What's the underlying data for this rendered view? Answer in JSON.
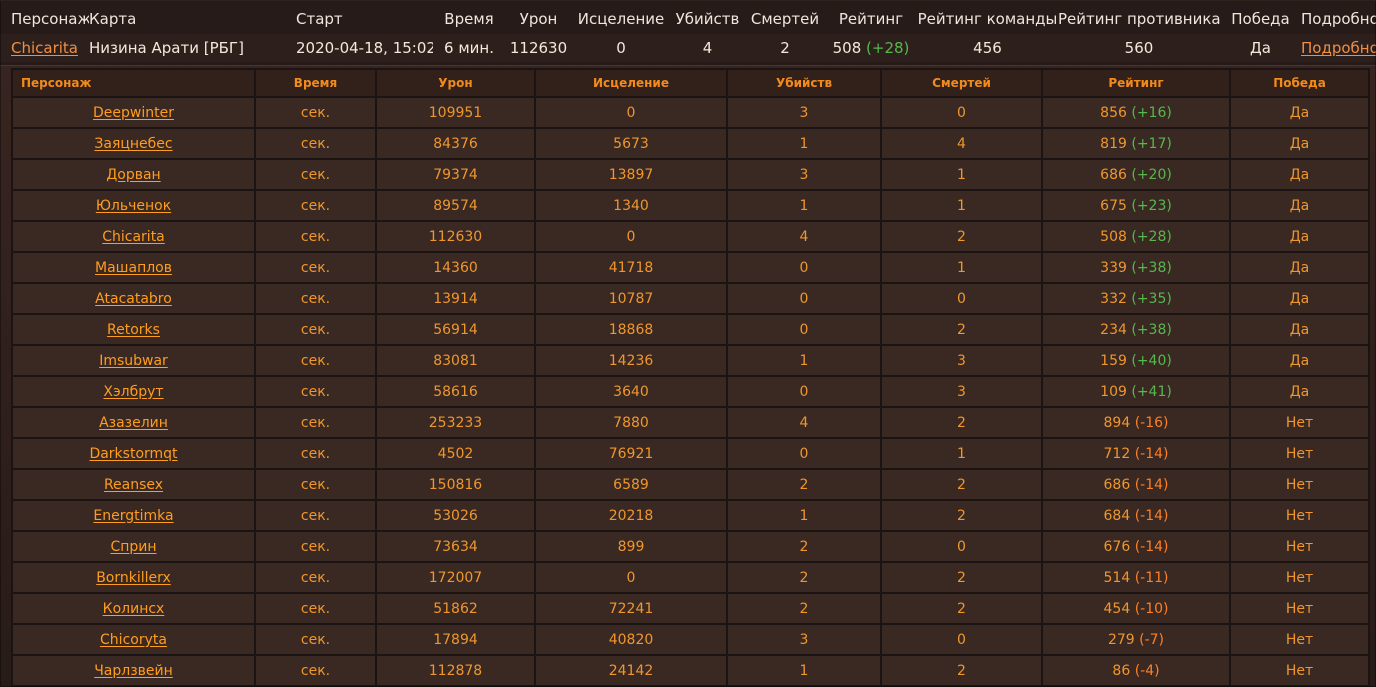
{
  "theme": {
    "background": "#2e201c",
    "header_accent": "#f28b1c",
    "link": "#ef8f47",
    "positive": "#56b84d",
    "negative": "#ff7f23"
  },
  "match_summary": {
    "headers": {
      "character": "Персонаж",
      "map": "Карта",
      "start": "Старт",
      "time": "Время",
      "damage": "Урон",
      "healing": "Исцеление",
      "kills": "Убийств",
      "deaths": "Смертей",
      "rating": "Рейтинг",
      "team_rating": "Рейтинг команды",
      "opponent_rating": "Рейтинг противника",
      "victory": "Победа",
      "details": "Подробно"
    },
    "row": {
      "character": "Chicarita",
      "map": "Низина Арати [РБГ]",
      "start": "2020-04-18, 15:02",
      "time": "6 мин.",
      "damage": "112630",
      "healing": "0",
      "kills": "4",
      "deaths": "2",
      "rating_base": "508",
      "rating_delta": "(+28)",
      "team_rating": "456",
      "opponent_rating": "560",
      "victory": "Да",
      "details": "Подробно"
    }
  },
  "player_table": {
    "headers": {
      "character": "Персонаж",
      "time": "Время",
      "damage": "Урон",
      "healing": "Исцеление",
      "kills": "Убийств",
      "deaths": "Смертей",
      "rating": "Рейтинг",
      "victory": "Победа"
    },
    "rows": [
      {
        "name": "Deepwinter",
        "time": "сек.",
        "damage": "109951",
        "healing": "0",
        "kills": "3",
        "deaths": "0",
        "rating_base": "856",
        "rating_delta": "(+16)",
        "victory": "Да"
      },
      {
        "name": "Заяцнебес",
        "time": "сек.",
        "damage": "84376",
        "healing": "5673",
        "kills": "1",
        "deaths": "4",
        "rating_base": "819",
        "rating_delta": "(+17)",
        "victory": "Да"
      },
      {
        "name": "Дорван",
        "time": "сек.",
        "damage": "79374",
        "healing": "13897",
        "kills": "3",
        "deaths": "1",
        "rating_base": "686",
        "rating_delta": "(+20)",
        "victory": "Да"
      },
      {
        "name": "Юльченок",
        "time": "сек.",
        "damage": "89574",
        "healing": "1340",
        "kills": "1",
        "deaths": "1",
        "rating_base": "675",
        "rating_delta": "(+23)",
        "victory": "Да"
      },
      {
        "name": "Chicarita",
        "time": "сек.",
        "damage": "112630",
        "healing": "0",
        "kills": "4",
        "deaths": "2",
        "rating_base": "508",
        "rating_delta": "(+28)",
        "victory": "Да"
      },
      {
        "name": "Машаплов",
        "time": "сек.",
        "damage": "14360",
        "healing": "41718",
        "kills": "0",
        "deaths": "1",
        "rating_base": "339",
        "rating_delta": "(+38)",
        "victory": "Да"
      },
      {
        "name": "Atacatabro",
        "time": "сек.",
        "damage": "13914",
        "healing": "10787",
        "kills": "0",
        "deaths": "0",
        "rating_base": "332",
        "rating_delta": "(+35)",
        "victory": "Да"
      },
      {
        "name": "Retorks",
        "time": "сек.",
        "damage": "56914",
        "healing": "18868",
        "kills": "0",
        "deaths": "2",
        "rating_base": "234",
        "rating_delta": "(+38)",
        "victory": "Да"
      },
      {
        "name": "Imsubwar",
        "time": "сек.",
        "damage": "83081",
        "healing": "14236",
        "kills": "1",
        "deaths": "3",
        "rating_base": "159",
        "rating_delta": "(+40)",
        "victory": "Да"
      },
      {
        "name": "Хэлбрут",
        "time": "сек.",
        "damage": "58616",
        "healing": "3640",
        "kills": "0",
        "deaths": "3",
        "rating_base": "109",
        "rating_delta": "(+41)",
        "victory": "Да"
      },
      {
        "name": "Азазелин",
        "time": "сек.",
        "damage": "253233",
        "healing": "7880",
        "kills": "4",
        "deaths": "2",
        "rating_base": "894",
        "rating_delta": "(-16)",
        "victory": "Нет"
      },
      {
        "name": "Darkstormqt",
        "time": "сек.",
        "damage": "4502",
        "healing": "76921",
        "kills": "0",
        "deaths": "1",
        "rating_base": "712",
        "rating_delta": "(-14)",
        "victory": "Нет"
      },
      {
        "name": "Reansex",
        "time": "сек.",
        "damage": "150816",
        "healing": "6589",
        "kills": "2",
        "deaths": "2",
        "rating_base": "686",
        "rating_delta": "(-14)",
        "victory": "Нет"
      },
      {
        "name": "Energtimka",
        "time": "сек.",
        "damage": "53026",
        "healing": "20218",
        "kills": "1",
        "deaths": "2",
        "rating_base": "684",
        "rating_delta": "(-14)",
        "victory": "Нет"
      },
      {
        "name": "Сприн",
        "time": "сек.",
        "damage": "73634",
        "healing": "899",
        "kills": "2",
        "deaths": "0",
        "rating_base": "676",
        "rating_delta": "(-14)",
        "victory": "Нет"
      },
      {
        "name": "Bornkillerx",
        "time": "сек.",
        "damage": "172007",
        "healing": "0",
        "kills": "2",
        "deaths": "2",
        "rating_base": "514",
        "rating_delta": "(-11)",
        "victory": "Нет"
      },
      {
        "name": "Колинсх",
        "time": "сек.",
        "damage": "51862",
        "healing": "72241",
        "kills": "2",
        "deaths": "2",
        "rating_base": "454",
        "rating_delta": "(-10)",
        "victory": "Нет"
      },
      {
        "name": "Chicoryta",
        "time": "сек.",
        "damage": "17894",
        "healing": "40820",
        "kills": "3",
        "deaths": "0",
        "rating_base": "279",
        "rating_delta": "(-7)",
        "victory": "Нет"
      },
      {
        "name": "Чарлзвейн",
        "time": "сек.",
        "damage": "112878",
        "healing": "24142",
        "kills": "1",
        "deaths": "2",
        "rating_base": "86",
        "rating_delta": "(-4)",
        "victory": "Нет"
      }
    ]
  }
}
